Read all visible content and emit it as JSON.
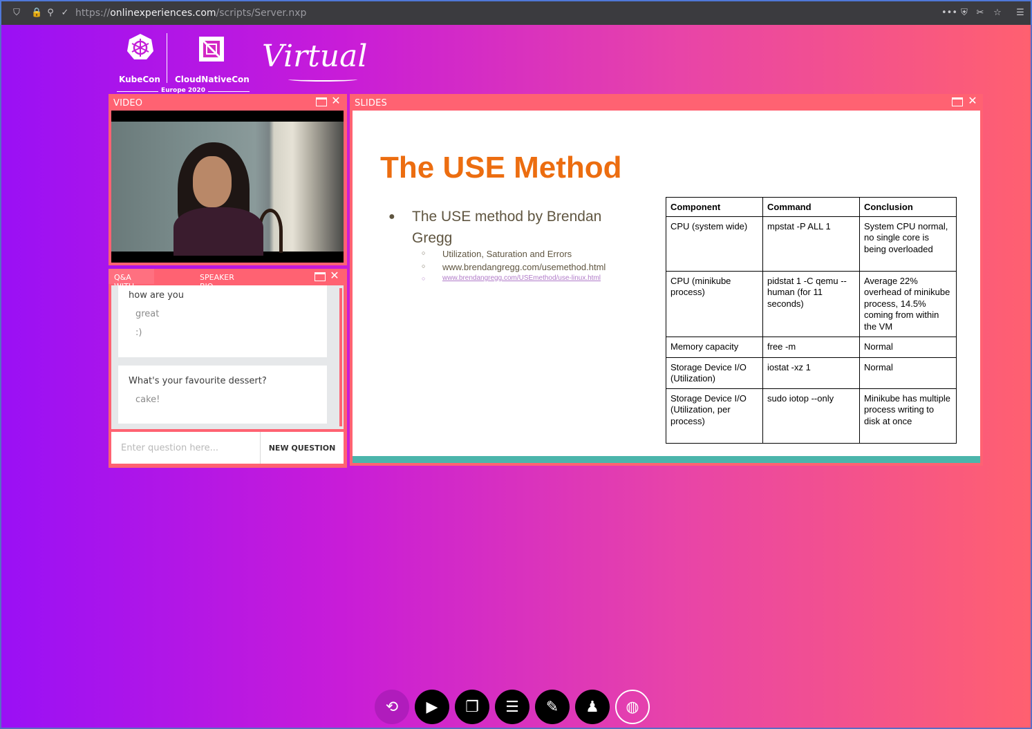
{
  "browser": {
    "url_scheme": "https://",
    "url_host": "onlinexperiences.com",
    "url_path": "/scripts/Server.nxp"
  },
  "logo": {
    "kubecon": "KubeCon",
    "cloudnativecon": "CloudNativeCon",
    "edition": "Europe 2020",
    "virtual": "Virtual"
  },
  "video_panel": {
    "title": "VIDEO"
  },
  "qa_panel": {
    "tab_qa": "Q&A WITH SPEAKER",
    "tab_bio": "SPEAKER BIO",
    "items": [
      {
        "question": "how are you",
        "answers": [
          "great",
          ":)"
        ]
      },
      {
        "question": "What's your favourite dessert?",
        "answers": [
          "cake!"
        ]
      }
    ],
    "input_placeholder": "Enter question here...",
    "new_question_label": "NEW QUESTION"
  },
  "slides_panel": {
    "title": "SLIDES",
    "slide": {
      "heading": "The USE Method",
      "bullet": "The USE method by Brendan Gregg",
      "subbullets": [
        "Utilization, Saturation and Errors",
        "www.brendangregg.com/usemethod.html",
        "www.brendangregg.com/USEmethod/use-linux.html"
      ],
      "table": {
        "headers": [
          "Component",
          "Command",
          "Conclusion"
        ],
        "rows": [
          [
            "CPU (system wide)",
            "mpstat -P ALL 1",
            "System CPU normal, no single core is being overloaded"
          ],
          [
            "CPU (minikube process)",
            "pidstat 1 -C qemu --human (for 11 seconds)",
            "Average 22% overhead of minikube process, 14.5% coming from within the VM"
          ],
          [
            "Memory capacity",
            "free -m",
            "Normal"
          ],
          [
            "Storage Device I/O (Utilization)",
            "iostat -xz 1",
            "Normal"
          ],
          [
            "Storage Device I/O (Utilization, per process)",
            "sudo iotop --only",
            "Minikube has multiple process writing to disk at once"
          ]
        ]
      }
    }
  },
  "toolbar": {
    "buttons": [
      "refresh-icon",
      "video-icon",
      "slides-icon",
      "agenda-icon",
      "qa-icon",
      "speaker-icon",
      "globe-icon"
    ]
  }
}
